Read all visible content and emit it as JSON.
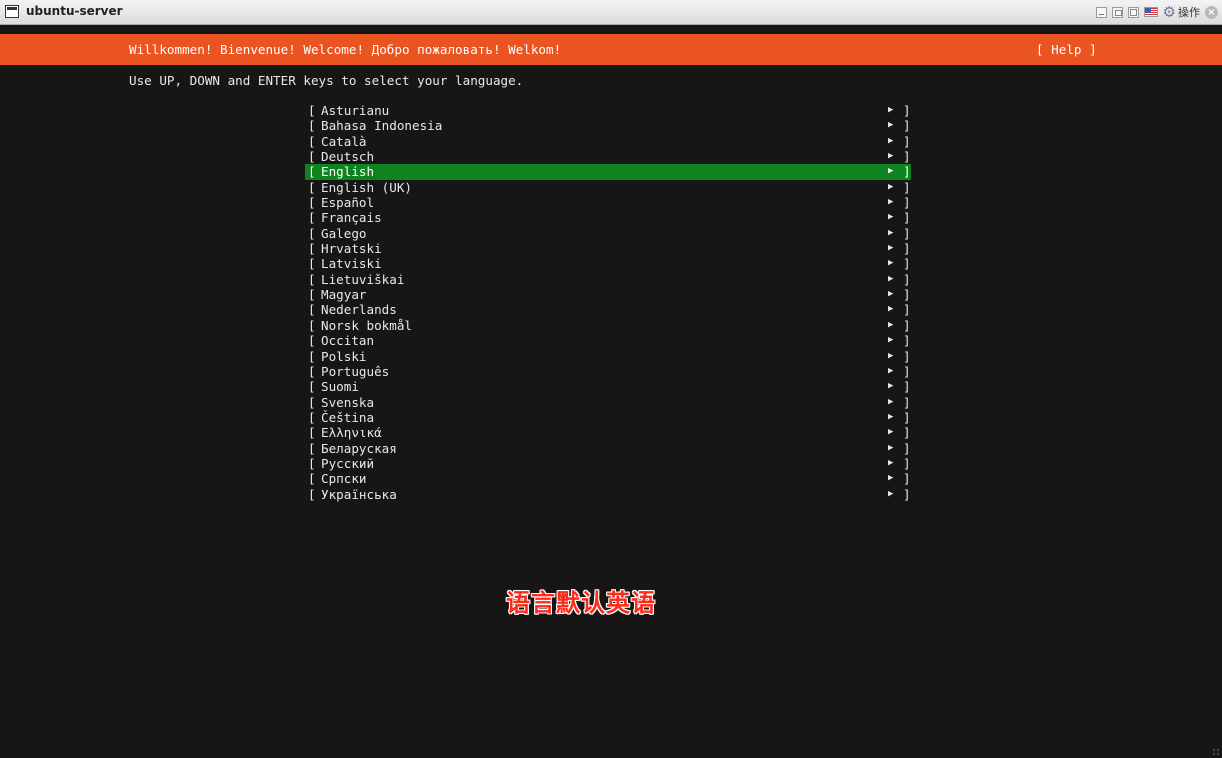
{
  "window": {
    "title": "ubuntu-server",
    "controls": {
      "ops_label": "操作",
      "icons": [
        "minimize-icon",
        "restore-icon",
        "maximize-icon",
        "flag-icon",
        "gear-icon",
        "close-icon"
      ]
    }
  },
  "installer": {
    "header_title": "Willkommen! Bienvenue! Welcome! Добро пожаловать! Welkom!",
    "help_label": "[ Help ]",
    "instructions": "Use UP, DOWN and ENTER keys to select your language.",
    "left_bracket": "[",
    "right_bracket": "]",
    "arrow_glyph": "▶",
    "selected_language": "English",
    "languages": [
      "Asturianu",
      "Bahasa Indonesia",
      "Català",
      "Deutsch",
      "English",
      "English (UK)",
      "Español",
      "Français",
      "Galego",
      "Hrvatski",
      "Latviski",
      "Lietuviškai",
      "Magyar",
      "Nederlands",
      "Norsk bokmål",
      "Occitan",
      "Polski",
      "Português",
      "Suomi",
      "Svenska",
      "Čeština",
      "Ελληνικά",
      "Беларуская",
      "Русский",
      "Српски",
      "Українська"
    ]
  },
  "caption": "语言默认英语",
  "colors": {
    "header_bg": "#e95420",
    "selected_bg": "#0e8420",
    "terminal_bg": "#161616",
    "text": "#e8e8e8",
    "caption": "#ff2a1a"
  }
}
